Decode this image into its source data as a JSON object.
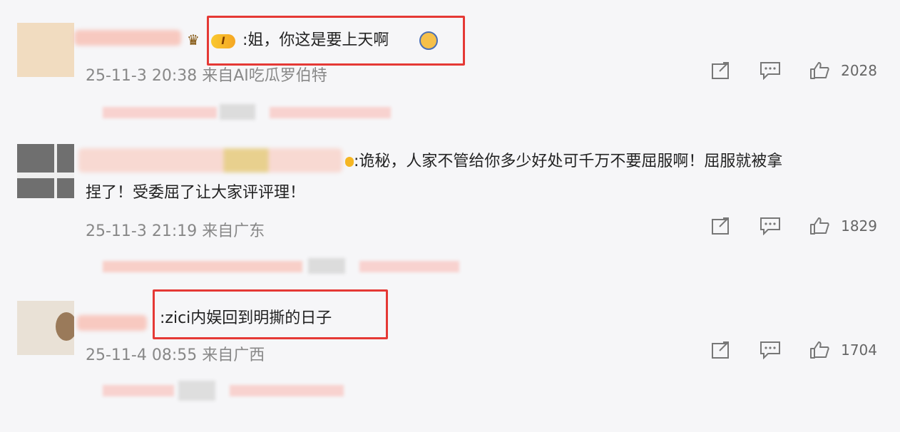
{
  "comments": [
    {
      "text": ":姐，你这是要上天啊",
      "meta": "25-11-3 20:38 来自AI吃瓜罗伯特",
      "likes": "2028",
      "badge": "I"
    },
    {
      "text_line1": ":诡秘，人家不管给你多少好处可千万不要屈服啊！屈服就被拿",
      "text_line2": "捏了！受委屈了让大家评评理！",
      "meta": "25-11-3 21:19 来自广东",
      "likes": "1829"
    },
    {
      "text": ":zici内娱回到明撕的日子",
      "meta": "25-11-4 08:55 来自广西",
      "likes": "1704"
    }
  ],
  "icons": [
    "share-icon",
    "comment-icon",
    "like-icon",
    "crown-icon",
    "emoji-icon"
  ],
  "colors": {
    "highlight": "#e53935",
    "background": "#f6f6f8",
    "meta": "#888888"
  }
}
